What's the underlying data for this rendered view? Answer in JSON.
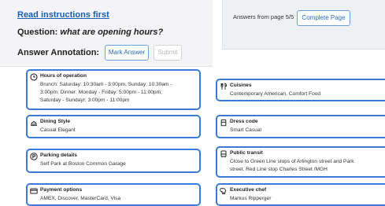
{
  "header": {
    "instructions_link": "Read instructions first",
    "question_prefix": "Question: ",
    "question_text": "what are opening hours?",
    "annotation_label": "Answer Annotation:",
    "mark_answer": "Mark Answer",
    "submit": "Submit",
    "answers_from": "Answers from page 5/5",
    "complete_page": "Complete Page"
  },
  "cards": {
    "hours": {
      "icon": "clock-icon",
      "title": "Hours of operation",
      "lines": [
        "Brunch: Saturday: 10:30am - 3:00pm, Sunday: 10:30am -",
        "3:00pm; Dinner: Monday - Friday: 5:00pm - 11:00pm;",
        "Saturday - Sundayr: 3:00pm - 11:00pm"
      ]
    },
    "cuisines": {
      "icon": "utensils-icon",
      "title": "Cuisines",
      "lines": [
        "Contemporary American, Comfort Food"
      ]
    },
    "dining": {
      "icon": "cloche-icon",
      "title": "Dining Style",
      "lines": [
        "Casual Elegant"
      ]
    },
    "dress": {
      "icon": "hanger-icon",
      "title": "Dress code",
      "lines": [
        "Smart Casual"
      ]
    },
    "parking": {
      "icon": "parking-icon",
      "title": "Parking details",
      "lines": [
        "Self Park at Boston Common Garage"
      ]
    },
    "transit": {
      "icon": "bus-icon",
      "title": "Public transit",
      "lines": [
        "Close to Green Line stops of Arlington street and Park",
        "street. Red Line stop Charles Street /MGH"
      ]
    },
    "payment": {
      "icon": "credit-card-icon",
      "title": "Payment options",
      "lines": [
        "AMEX, Discover, MasterCard, Visa"
      ]
    },
    "chef": {
      "icon": "chef-hat-icon",
      "title": "Executive chef",
      "lines": [
        "Markus Ripperger"
      ]
    }
  },
  "colors": {
    "accent": "#3a7bd5",
    "link": "#1a5fb4"
  }
}
